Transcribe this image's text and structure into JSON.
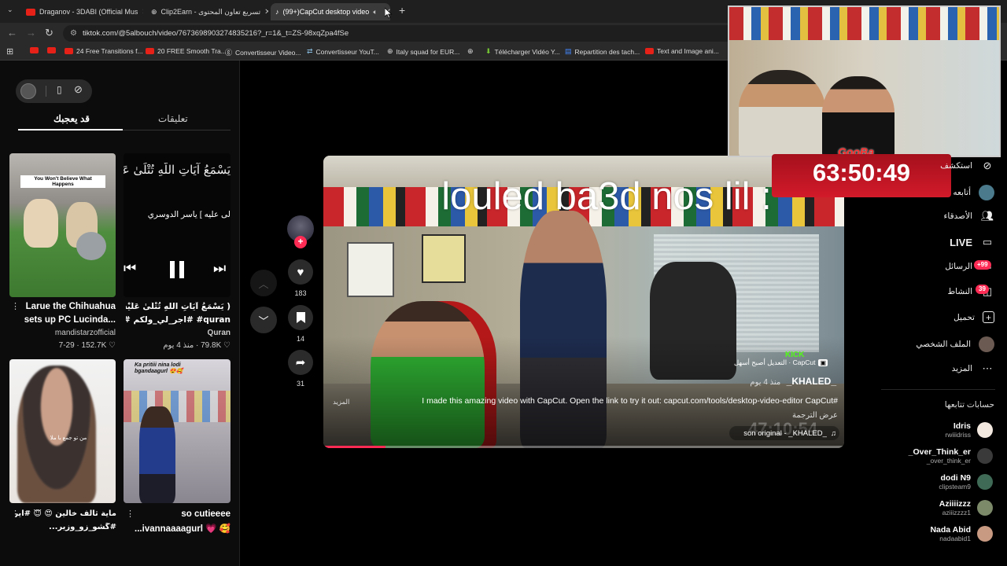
{
  "browser": {
    "tabs": [
      {
        "title": "Draganov - 3DABI (Official Mus"
      },
      {
        "title": "Clip2Earn - تسريع تعاون المحتوى"
      },
      {
        "title": "(99+)CapCut desktop video"
      }
    ],
    "url": "tiktok.com/@5albouch/video/7673698903274835216?_r=1&_t=ZS-98xqZpa4fSe",
    "bookmarks": [
      "24 Free Transitions f...",
      "20 FREE Smooth Tra...",
      "Convertisseur Video...",
      "Convertisseur YouT...",
      "Italy squad for EUR...",
      "Télécharger Vidéo Y...",
      "Repartition des tach...",
      "Text and Image ani..."
    ]
  },
  "left": {
    "tabs": {
      "you_may_like": "قد يعجبك",
      "comments": "تعليقات"
    },
    "cards": [
      {
        "overlay": "You Won't Believe What Happens",
        "title1": "Larue the Chihuahua",
        "title2": "...sets up PC Lucinda",
        "author": "mandistarzofficial",
        "date": "7-29",
        "likes": "152.7K"
      },
      {
        "overlay": "يَسْمَعُ آيَاتِ اللَّهِ تُتْلَىٰ عَلَيْ",
        "caption": "لى عليه ] ياسر الدوسري",
        "title1": "( يَسْمَعُ آيَاتِ اللَّهِ تُتْلَىٰ عَلَيْهِ )",
        "title2": "quran# #اجر_لي_ولكم #p...",
        "author": "Quran",
        "date": "منذ 4 يوم",
        "likes": "79.8K"
      },
      {
        "overlay": "من تو جمع با ملا",
        "title1": "ماية ثالف خالين 😍 😇 #ايرال",
        "title2": "#گشو_زو_وزير...",
        "author": "",
        "date": "",
        "likes": ""
      },
      {
        "overlay": "Ka pritiii nina lodi bgandaagurl 😍🥰",
        "title1": "so cutieeee",
        "title2": "...ivannaaaagurl 💗 🥰",
        "author": "",
        "date": "",
        "likes": ""
      }
    ]
  },
  "video": {
    "overlay_text": "louled ba3d nos lil :",
    "username": "_KHALED_",
    "posted": "منذ 4 يوم",
    "template": "CapCut · التعديل أصبح أسهل",
    "description": "I made this amazing video with CapCut. Open the link to try it out: capcut.com/tools/desktop-video-editor CapCut#",
    "more": "المزيد",
    "translate": "عرض الترجمة",
    "sound": "son original - _KHALED_",
    "faded_time": "47:10:54",
    "kick": "KICK",
    "progress": 0.12
  },
  "actions": {
    "likes": "183",
    "saves": "14",
    "shares": "31"
  },
  "right_nav": {
    "items": [
      {
        "label": "استكشف",
        "icon": "compass-icon"
      },
      {
        "label": "أتابعه",
        "icon": "following-icon"
      },
      {
        "label": "الأصدقاء",
        "icon": "friends-icon"
      },
      {
        "label": "LIVE",
        "icon": "live-icon"
      },
      {
        "label": "الرسائل",
        "icon": "messages-icon",
        "badge": "+99"
      },
      {
        "label": "النشاط",
        "icon": "activity-icon",
        "badge": "39"
      },
      {
        "label": "تحميل",
        "icon": "upload-icon"
      },
      {
        "label": "الملف الشخصي",
        "icon": "profile-icon"
      },
      {
        "label": "المزيد",
        "icon": "more-icon"
      }
    ],
    "following_header": "حسابات تتابعها",
    "following": [
      {
        "name": "Idris",
        "handle": "rwiiidriss"
      },
      {
        "name": "_Over_Think_er",
        "handle": "_over_think_er"
      },
      {
        "name": "dodi N9",
        "handle": "clipsteam9"
      },
      {
        "name": "Aziiiizzz",
        "handle": "aziiizzzz1"
      },
      {
        "name": "Nada Abid",
        "handle": "nadaabid1"
      }
    ]
  },
  "overlay": {
    "timer": "63:50:49",
    "brand": "GooBa"
  },
  "colors": {
    "accent": "#fe2c55",
    "timer_bg": "#c8121f"
  }
}
